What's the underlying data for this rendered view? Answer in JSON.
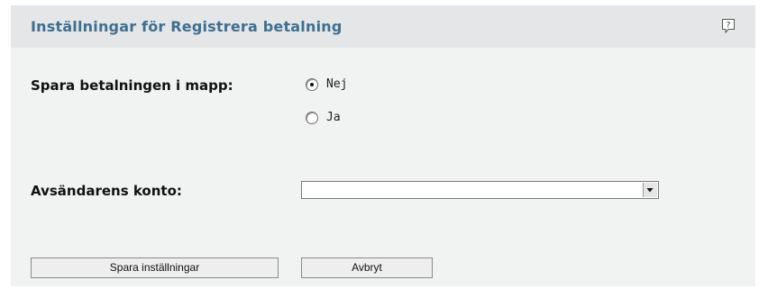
{
  "header": {
    "title": "Inställningar för Registrera betalning",
    "help_icon": "help-icon"
  },
  "form": {
    "save_in_folder": {
      "label": "Spara betalningen i mapp:",
      "options": [
        {
          "label": "Nej",
          "selected": true
        },
        {
          "label": "Ja",
          "selected": false
        }
      ]
    },
    "sender_account": {
      "label": "Avsändarens konto:",
      "value": ""
    }
  },
  "actions": {
    "save_label": "Spara inställningar",
    "cancel_label": "Avbryt"
  },
  "colors": {
    "header_bg": "#e4e6e8",
    "panel_bg": "#f1f2f2",
    "title": "#3f6f8f"
  }
}
